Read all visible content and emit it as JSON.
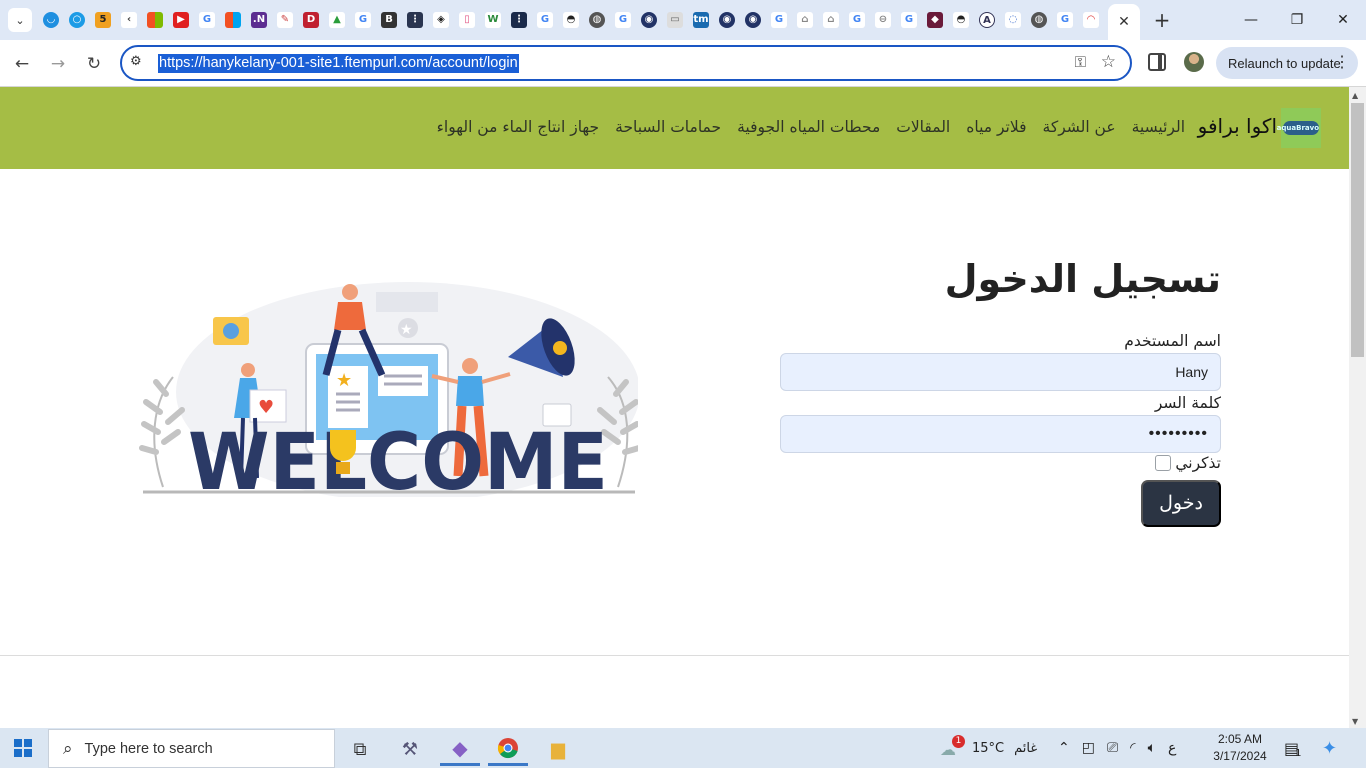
{
  "browser": {
    "url": "https://hanykelany-001-site1.ftempurl.com/account/login",
    "relaunch_label": "Relaunch to update",
    "active_tab_close": "✕",
    "new_tab": "+"
  },
  "site": {
    "brand": "اكوا برافو",
    "logo_text": "aquaBravo",
    "nav": [
      "الرئيسية",
      "عن الشركة",
      "فلاتر مياه",
      "المقالات",
      "محطات المياه الجوفية",
      "حمامات السباحة",
      "جهاز انتاج الماء من الهواء"
    ]
  },
  "login": {
    "title": "تسجيل الدخول",
    "username_label": "اسم المستخدم",
    "username_value": "Hany",
    "password_label": "كلمة السر",
    "password_value": "•••••••••",
    "remember_label": "تذكرني",
    "remember_checked": false,
    "submit_label": "دخول"
  },
  "illustration": {
    "word": "WELCOME"
  },
  "taskbar": {
    "search_placeholder": "Type here to search",
    "weather_temp": "15°C",
    "weather_desc": "غائم",
    "weather_badge": "1",
    "lang": "ع",
    "time": "2:05 AM",
    "date": "3/17/2024",
    "notification_count": "1"
  },
  "colors": {
    "navbar": "#a5bd45",
    "button": "#2b3443",
    "input_bg": "#e8f0fe",
    "url_highlight": "#1a5fd6"
  }
}
